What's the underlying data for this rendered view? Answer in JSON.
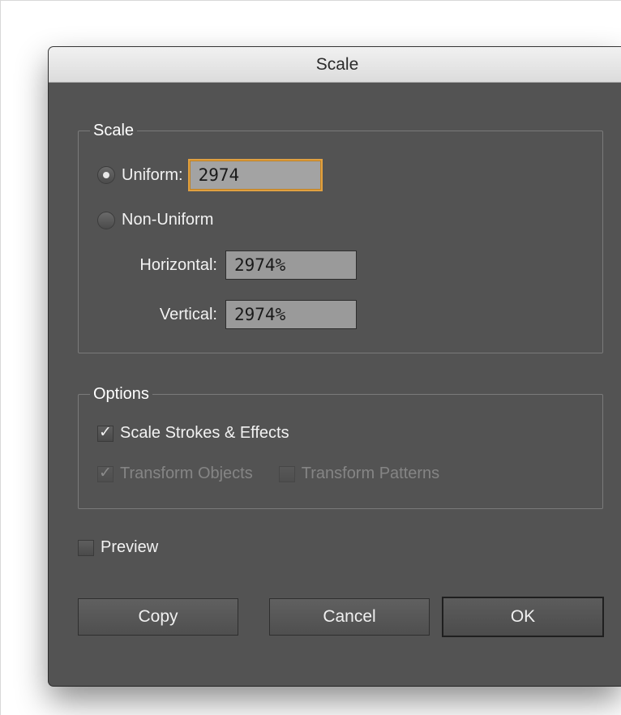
{
  "dialog": {
    "title": "Scale"
  },
  "scale_group": {
    "legend": "Scale",
    "uniform_label": "Uniform:",
    "uniform_value": "2974",
    "uniform_selected": true,
    "non_uniform_label": "Non-Uniform",
    "horizontal_label": "Horizontal:",
    "horizontal_value": "2974%",
    "vertical_label": "Vertical:",
    "vertical_value": "2974%"
  },
  "options_group": {
    "legend": "Options",
    "scale_strokes_label": "Scale Strokes & Effects",
    "scale_strokes_checked": true,
    "transform_objects_label": "Transform Objects",
    "transform_objects_checked": true,
    "transform_patterns_label": "Transform Patterns",
    "transform_patterns_checked": false
  },
  "preview": {
    "label": "Preview",
    "checked": false
  },
  "buttons": {
    "copy": "Copy",
    "cancel": "Cancel",
    "ok": "OK"
  },
  "colors": {
    "dialog_bg": "#535353",
    "focus_ring": "#e0a040",
    "field_bg": "#9a9a9a"
  }
}
